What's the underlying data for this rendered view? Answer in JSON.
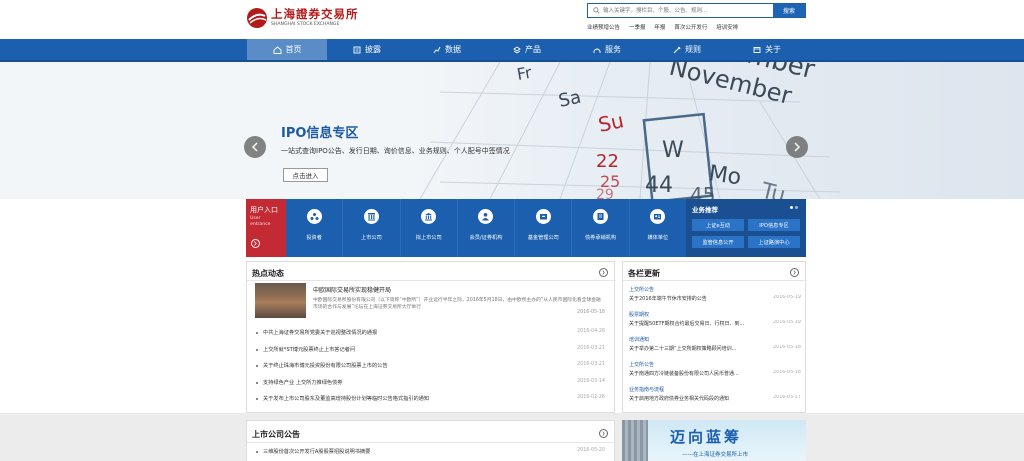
{
  "header": {
    "logo_cn": "上海證券交易所",
    "logo_en": "SHANGHAI STOCK EXCHANGE",
    "search_placeholder": "输入关键字，搜栏目、个股、公告、规则...",
    "search_button": "搜索",
    "quick_links": [
      "业绩预增公告",
      "一季报",
      "年报",
      "首次公开发行",
      "培训安排"
    ]
  },
  "nav": {
    "items": [
      {
        "label": "首页",
        "icon": "home-icon",
        "active": true
      },
      {
        "label": "披露",
        "icon": "disclosure-icon"
      },
      {
        "label": "数据",
        "icon": "data-icon"
      },
      {
        "label": "产品",
        "icon": "product-icon"
      },
      {
        "label": "服务",
        "icon": "service-icon"
      },
      {
        "label": "规则",
        "icon": "rules-icon"
      },
      {
        "label": "关于",
        "icon": "about-icon"
      }
    ]
  },
  "banner": {
    "title": "IPO信息专区",
    "subtitle": "一站式查询IPO公告、发行日期、询价信息、业务规则、个人配号中签情况",
    "button": "点击进入",
    "calendar_words": [
      "Fr",
      "Sa",
      "Su",
      "W",
      "Mo",
      "Tu",
      "November",
      "ember"
    ],
    "calendar_numbers": [
      "22",
      "25",
      "29",
      "44",
      "45"
    ]
  },
  "user_entrance": {
    "title": "用户入口",
    "en_line1": "User",
    "en_line2": "entrance"
  },
  "tiles": [
    {
      "label": "投资者",
      "icon": "investor-icon"
    },
    {
      "label": "上市公司",
      "icon": "listed-company-icon"
    },
    {
      "label": "拟上市公司",
      "icon": "pre-ipo-icon"
    },
    {
      "label": "会员/证券机构",
      "icon": "member-icon"
    },
    {
      "label": "基金管理公司",
      "icon": "fund-icon"
    },
    {
      "label": "债券承销机构",
      "icon": "bond-icon"
    },
    {
      "label": "媒体单位",
      "icon": "media-icon"
    }
  ],
  "business": {
    "title": "业务推荐",
    "buttons": [
      "上证e互动",
      "IPO信息专区",
      "监管信息公开",
      "上证路演中心"
    ]
  },
  "hot": {
    "title": "热点动态",
    "featured": {
      "title": "中欧国际交易所实现稳健开局",
      "desc": "中欧国际交易所股份有限公司（以下简称“中欧所”）开业运行半年之际，2016年5月18日，由中欧所主办的“从人民币国际化看全球金融市场的合作与发展”论坛在上海证券交易所大厅举行",
      "date": "2016-05-18"
    },
    "items": [
      {
        "text": "中共上海证券交易所党委关于巡视整改情况的通报",
        "date": "2016-04-26"
      },
      {
        "text": "上交所就*ST博元股票终止上市答记者问",
        "date": "2016-03-21"
      },
      {
        "text": "关于终止珠海市博元投资股份有限公司股票上市的公告",
        "date": "2016-03-21"
      },
      {
        "text": "支持绿色产业 上交所力推绿色债券",
        "date": "2016-03-14"
      },
      {
        "text": "关于发布上市公司股东及董监高增持股份计划等临时公告格式指引的通知",
        "date": "2016-02-26"
      }
    ]
  },
  "columns": {
    "title": "各栏更新",
    "groups": [
      {
        "cat": "上交所公告",
        "text": "关于2016年端午节休市安排的公告",
        "date": "2016-05-19"
      },
      {
        "cat": "股票期权",
        "text": "关于提醒50ETF期权合约最后交易日、行权日、到...",
        "date": "2016-05-19"
      },
      {
        "cat": "培训通知",
        "text": "关于举办第二十三期“上交所期权策略顾问培训...",
        "date": "2016-05-18"
      },
      {
        "cat": "上交所公告",
        "text": "关于南通四方冷链装备股份有限公司人民币普通...",
        "date": "2016-05-18"
      },
      {
        "cat": "业务指南与流程",
        "text": "关于启用地方政府债券业务相关代码段的通知",
        "date": "2016-05-17"
      }
    ]
  },
  "announcements": {
    "title": "上市公司公告",
    "items": [
      {
        "text": "三维股份首次公开发行A股股票招股说明书摘要",
        "date": "2016-05-20"
      }
    ]
  },
  "ad": {
    "title": "迈向蓝筹",
    "subtitle": "——在上海证券交易所上市"
  },
  "colors": {
    "nav_blue": "#1b5fae",
    "tile_blue": "#1b5fae",
    "entrance_red": "#c32a33",
    "logo_red": "#b31b1b",
    "link_blue": "#1d5aa6"
  }
}
